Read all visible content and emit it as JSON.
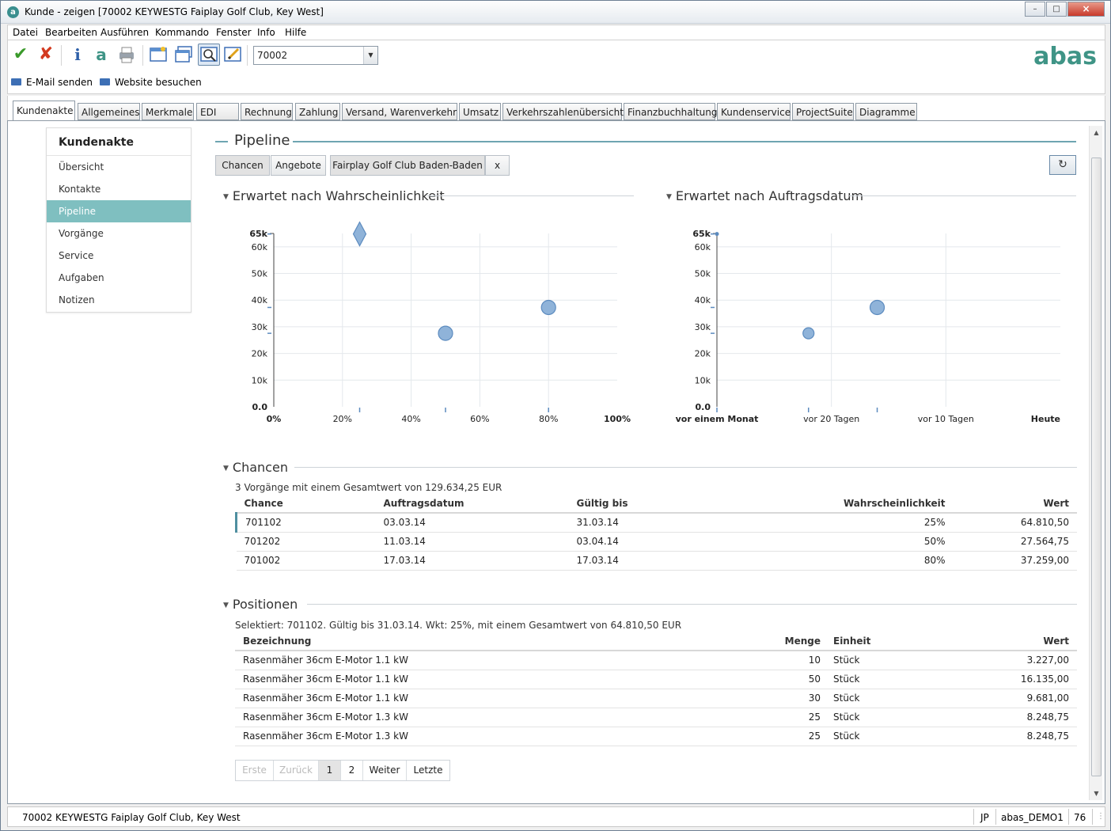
{
  "window": {
    "title": "Kunde - zeigen  [70002  KEYWESTG  Faiplay Golf Club, Key West]",
    "controls": [
      "minimize-icon",
      "maximize-icon",
      "close-icon"
    ]
  },
  "menubar": {
    "items": [
      "Datei",
      "Bearbeiten",
      "Ausführen",
      "Kommando",
      "Fenster",
      "Info",
      "Hilfe"
    ]
  },
  "toolbar": {
    "buttons": [
      "check-icon",
      "cancel-x-icon",
      "info-icon",
      "abas-a-icon",
      "printer-icon",
      "new-window-icon",
      "windows-icon",
      "search-magnifier-icon",
      "edit-pencil-icon"
    ],
    "record_value": "70002",
    "brand": "abas",
    "brand_color": "#3f9486"
  },
  "actions": {
    "email": "E-Mail senden",
    "website": "Website besuchen"
  },
  "tabs": [
    "Kundenakte",
    "Allgemeines",
    "Merkmale",
    "EDI",
    "Rechnung",
    "Zahlung",
    "Versand, Warenverkehr",
    "Umsatz",
    "Verkehrszahlenübersicht",
    "Finanzbuchhaltung",
    "Kundenservice",
    "ProjectSuite",
    "Diagramme"
  ],
  "active_tab": "Kundenakte",
  "sidenav": {
    "title": "Kundenakte",
    "items": [
      "Übersicht",
      "Kontakte",
      "Pipeline",
      "Vorgänge",
      "Service",
      "Aufgaben",
      "Notizen"
    ],
    "active": "Pipeline"
  },
  "pipeline": {
    "title": "Pipeline",
    "filters": [
      "Chancen",
      "Angebote",
      "Fairplay Golf Club Baden-Baden",
      "x"
    ],
    "refresh_icon": "refresh-icon",
    "accent": "#6ea5b1"
  },
  "chart_data": [
    {
      "type": "scatter",
      "title": "Erwartet nach Wahrscheinlichkeit",
      "xlabel": "",
      "ylabel": "",
      "x_ticks": [
        "0%",
        "20%",
        "40%",
        "60%",
        "80%",
        "100%"
      ],
      "y_ticks": [
        "0.0",
        "10k",
        "20k",
        "30k",
        "40k",
        "50k",
        "60k",
        "65k"
      ],
      "xlim": [
        0,
        100
      ],
      "ylim": [
        0,
        65000
      ],
      "grid": true,
      "points": [
        {
          "x": 25,
          "y": 64810.5,
          "marker": "diamond"
        },
        {
          "x": 50,
          "y": 27564.75,
          "marker": "circle"
        },
        {
          "x": 80,
          "y": 37259.0,
          "marker": "circle"
        }
      ],
      "color": "#8fb3d9"
    },
    {
      "type": "scatter",
      "title": "Erwartet nach Auftragsdatum",
      "xlabel": "",
      "ylabel": "",
      "x_ticks": [
        "vor einem Monat",
        "vor 20 Tagen",
        "vor 10 Tagen",
        "Heute"
      ],
      "y_ticks": [
        "0.0",
        "10k",
        "20k",
        "30k",
        "40k",
        "50k",
        "60k",
        "65k"
      ],
      "xlim": [
        -30,
        0
      ],
      "ylim": [
        0,
        65000
      ],
      "grid": true,
      "points": [
        {
          "x": -30,
          "y": 64810.5,
          "marker": "dot"
        },
        {
          "x": -22,
          "y": 27564.75,
          "marker": "circle"
        },
        {
          "x": -16,
          "y": 37259.0,
          "marker": "circle"
        }
      ],
      "color": "#8fb3d9"
    }
  ],
  "chancen": {
    "title": "Chancen",
    "summary": "3 Vorgänge mit einem Gesamtwert von 129.634,25 EUR",
    "columns": [
      "Chance",
      "Auftragsdatum",
      "Gültig bis",
      "Wahrscheinlichkeit",
      "Wert"
    ],
    "rows": [
      [
        "701102",
        "03.03.14",
        "31.03.14",
        "25%",
        "64.810,50"
      ],
      [
        "701202",
        "11.03.14",
        "03.04.14",
        "50%",
        "27.564,75"
      ],
      [
        "701002",
        "17.03.14",
        "17.03.14",
        "80%",
        "37.259,00"
      ]
    ]
  },
  "positionen": {
    "title": "Positionen",
    "summary": "Selektiert: 701102. Gültig bis 31.03.14. Wkt: 25%, mit einem Gesamtwert von 64.810,50 EUR",
    "columns": [
      "Bezeichnung",
      "Menge",
      "Einheit",
      "Wert"
    ],
    "rows": [
      [
        "Rasenmäher 36cm E-Motor 1.1 kW",
        "10",
        "Stück",
        "3.227,00"
      ],
      [
        "Rasenmäher 36cm E-Motor 1.1 kW",
        "50",
        "Stück",
        "16.135,00"
      ],
      [
        "Rasenmäher 36cm E-Motor 1.1 kW",
        "30",
        "Stück",
        "9.681,00"
      ],
      [
        "Rasenmäher 36cm E-Motor 1.3 kW",
        "25",
        "Stück",
        "8.248,75"
      ],
      [
        "Rasenmäher 36cm E-Motor 1.3 kW",
        "25",
        "Stück",
        "8.248,75"
      ]
    ]
  },
  "pager": {
    "first": "Erste",
    "prev": "Zurück",
    "pages": [
      "1",
      "2"
    ],
    "current": "1",
    "next": "Weiter",
    "last": "Letzte"
  },
  "status": {
    "record": "70002 KEYWESTG  Faiplay Golf Club, Key West",
    "user": "JP",
    "client": "abas_DEMO1",
    "number": "76"
  }
}
